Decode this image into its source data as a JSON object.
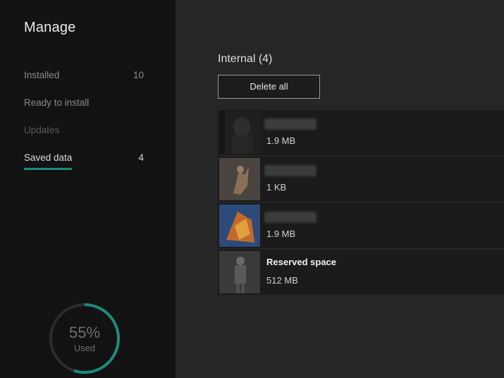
{
  "sidebar": {
    "title": "Manage",
    "items": [
      {
        "label": "Installed",
        "count": "10"
      },
      {
        "label": "Ready to install",
        "count": ""
      },
      {
        "label": "Updates",
        "count": ""
      },
      {
        "label": "Saved data",
        "count": "4"
      }
    ]
  },
  "storage": {
    "percent": "55%",
    "label": "Used",
    "fraction": 0.55,
    "accent": "#1d8a7b"
  },
  "main": {
    "heading": "Internal (4)",
    "delete_label": "Delete all",
    "items": [
      {
        "title": "",
        "size": "1.9 MB",
        "thumb": "dark-portrait"
      },
      {
        "title": "",
        "size": "1 KB",
        "thumb": "tan-figure"
      },
      {
        "title": "",
        "size": "1.9 MB",
        "thumb": "blue-orange-art"
      },
      {
        "title": "Reserved space",
        "size": "512 MB",
        "thumb": "grey-figure"
      }
    ]
  }
}
